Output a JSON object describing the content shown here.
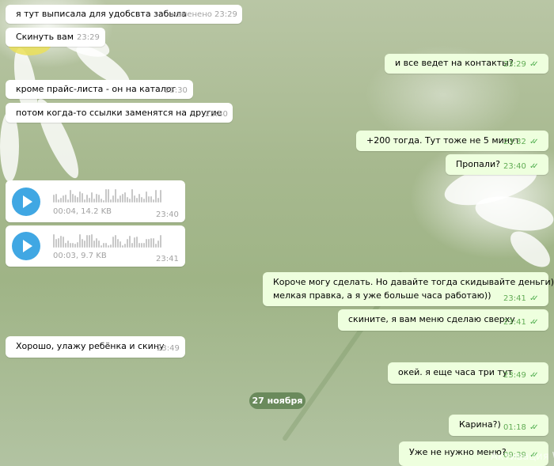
{
  "messages": [
    {
      "text": "я тут выписала для удобсвта забыла",
      "time": "изменено 23:29"
    },
    {
      "text": "Скинуть вам",
      "time": "23:29"
    },
    {
      "text": "и все ведет на контакты?",
      "time": "23:29"
    },
    {
      "text": "кроме прайс-листа - он на каталог",
      "time": "23:30"
    },
    {
      "text": "потом когда-то ссылки заменятся на другие",
      "time": "23:30"
    },
    {
      "text": "+200 тогда. Тут тоже не 5 минут",
      "time": "23:32"
    },
    {
      "text": "Пропали?",
      "time": "23:40"
    },
    {
      "text": "Короче могу сделать. Но давайте тогда скидывайте деньги) а то",
      "text2": "мелкая правка, а я уже больше часа работаю))",
      "time": "23:41"
    },
    {
      "text": "скините, я вам меню сделаю сверху",
      "time": "23:41"
    },
    {
      "text": "Хорошо, улажу ребёнка и скину",
      "time": "23:49"
    },
    {
      "text": "окей. я еще часа три тут",
      "time": "23:49"
    },
    {
      "text": "Карина?)",
      "time": "01:18"
    },
    {
      "text": "Уже не нужно меню?",
      "time": "09:39"
    }
  ],
  "voice": [
    {
      "info": "00:04, 14.2 KB",
      "time": "23:40"
    },
    {
      "info": "00:03, 9.7 KB",
      "time": "23:41"
    }
  ],
  "date_separator": "27 ноября",
  "read_check": "✓✓",
  "watermark": "Активация W"
}
